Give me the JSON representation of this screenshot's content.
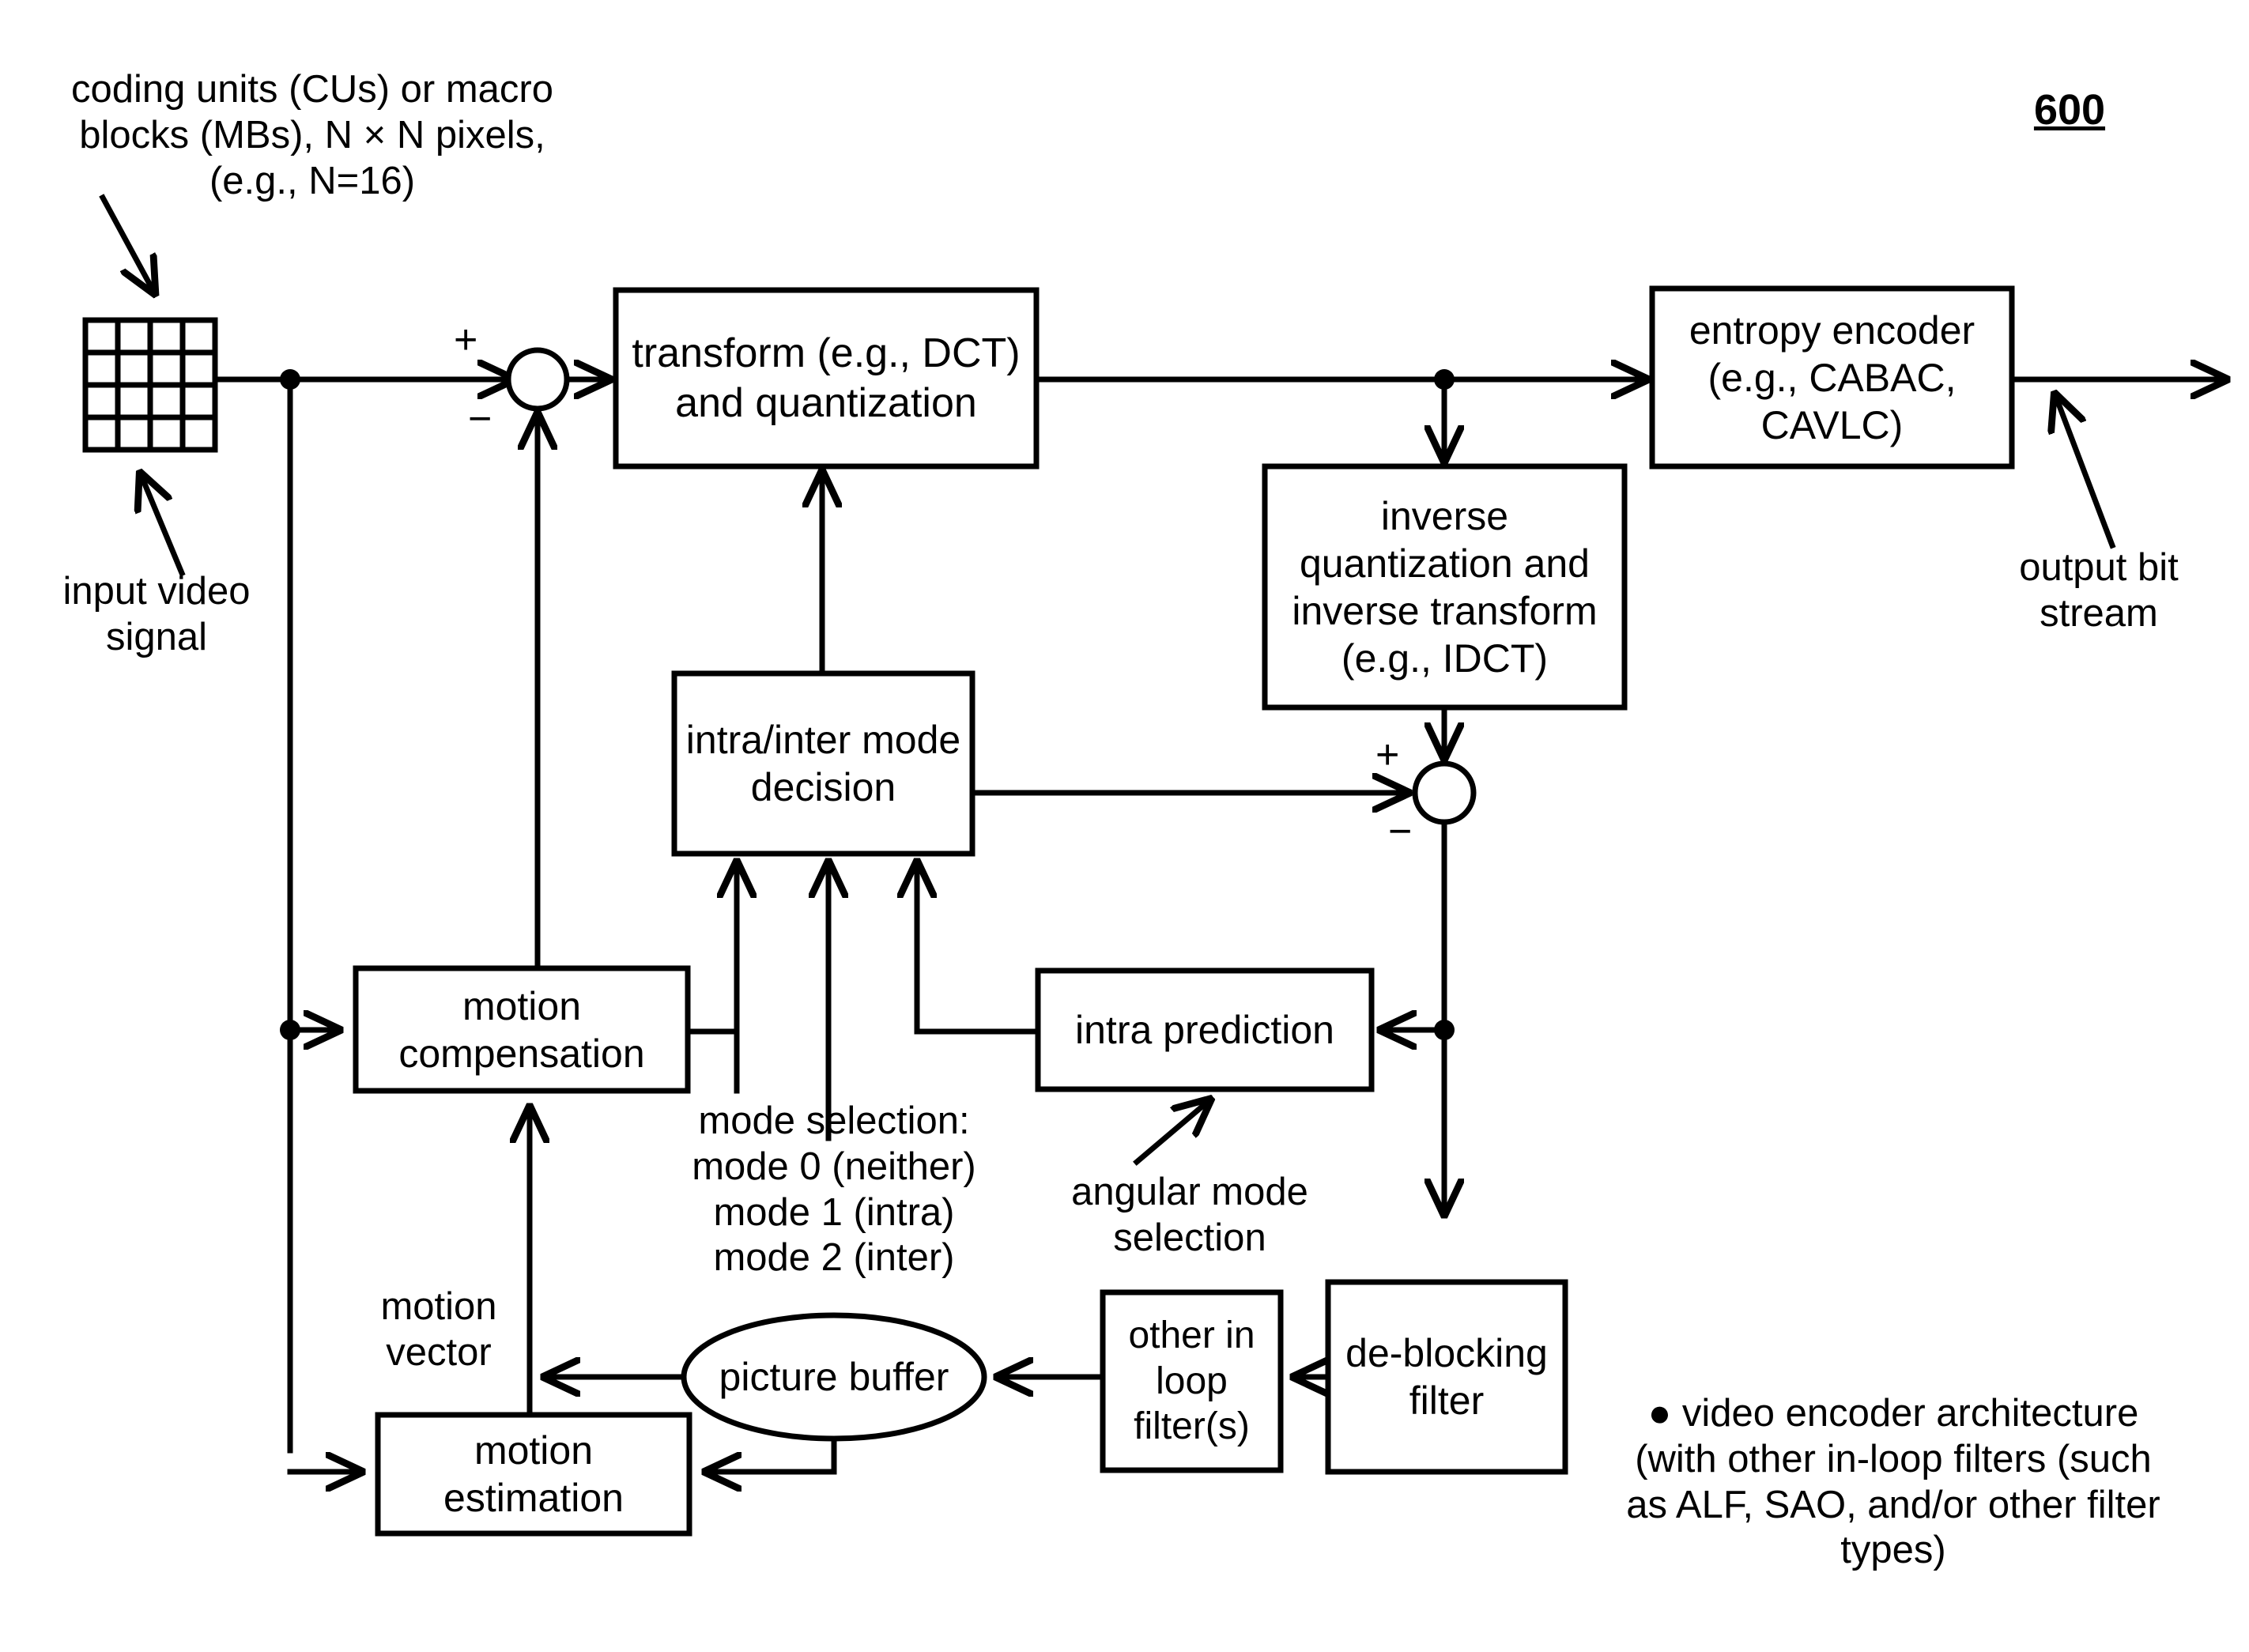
{
  "figure": {
    "number": "600",
    "title_note": "video encoder architecture block diagram"
  },
  "blocks": {
    "transform": "transform (e.g., DCT)\nand quantization",
    "entropy_encoder": "entropy encoder\n(e.g., CABAC,\nCAVLC)",
    "inverse_quant": "inverse\nquantization and\ninverse transform\n(e.g., IDCT)",
    "mode_decision": "intra/inter mode\ndecision",
    "motion_compensation": "motion\ncompensation",
    "intra_prediction": "intra prediction",
    "motion_estimation": "motion\nestimation",
    "picture_buffer": "picture buffer",
    "other_in_loop_filters": "other in\nloop\nfilter(s)",
    "deblocking_filter": "de-blocking\nfilter"
  },
  "annotations": {
    "input_block_desc": "coding units (CUs) or macro\nblocks (MBs), N × N pixels,\n(e.g., N=16)",
    "input_video_signal": "input video\nsignal",
    "output_bit_stream": "output bit\nstream",
    "mode_selection": "mode selection:\nmode 0 (neither)\nmode 1 (intra)\nmode 2 (inter)",
    "angular_mode_selection": "angular mode\nselection",
    "motion_vector": "motion\nvector",
    "caption": "● video encoder architecture\n(with other in-loop filters (such\nas ALF, SAO, and/or other filter\ntypes)"
  },
  "signs": {
    "adder1_plus": "+",
    "adder1_minus": "−",
    "adder2_plus": "+",
    "adder2_minus": "−"
  },
  "style": {
    "stroke": "#000000",
    "fill": "#ffffff"
  },
  "grid": {
    "rows": 4,
    "cols": 4
  }
}
